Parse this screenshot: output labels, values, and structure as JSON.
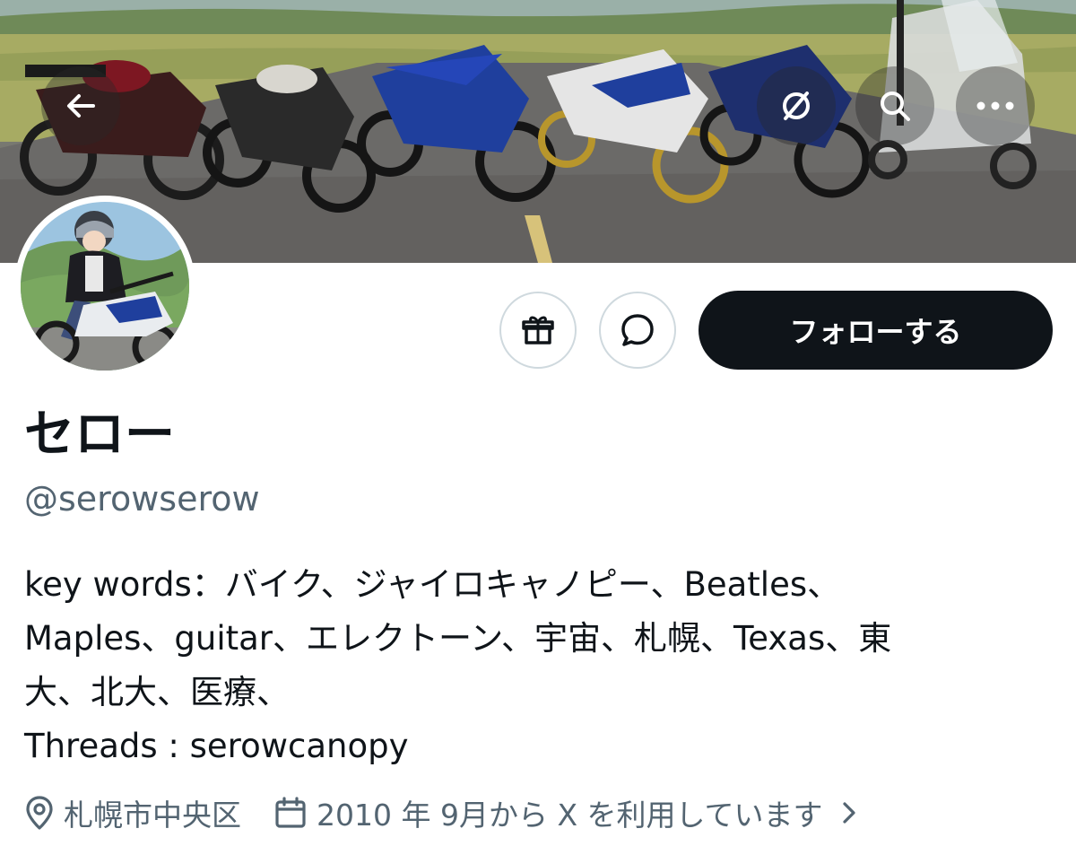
{
  "header": {
    "back_icon": "arrow-left-icon",
    "translate_icon": "translate-icon",
    "search_icon": "search-icon",
    "more_icon": "more-horizontal-icon"
  },
  "actions": {
    "gift_icon": "gift-icon",
    "message_icon": "message-bubble-icon",
    "follow_label": "フォローする"
  },
  "profile": {
    "display_name": "セロー",
    "handle": "@serowserow",
    "bio_lines": [
      "key words：バイク、ジャイロキャノピー、Beatles、",
      "Maples、guitar、エレクトーン、宇宙、札幌、Texas、東",
      "大、北大、医療、",
      "Threads : serowcanopy"
    ],
    "location": "札幌市中央区",
    "joined": "2010 年 9月から X を利用しています"
  },
  "colors": {
    "primary_text": "#0f1419",
    "secondary_text": "#536471",
    "button_bg": "#0f1419",
    "border": "#cfd9de"
  }
}
